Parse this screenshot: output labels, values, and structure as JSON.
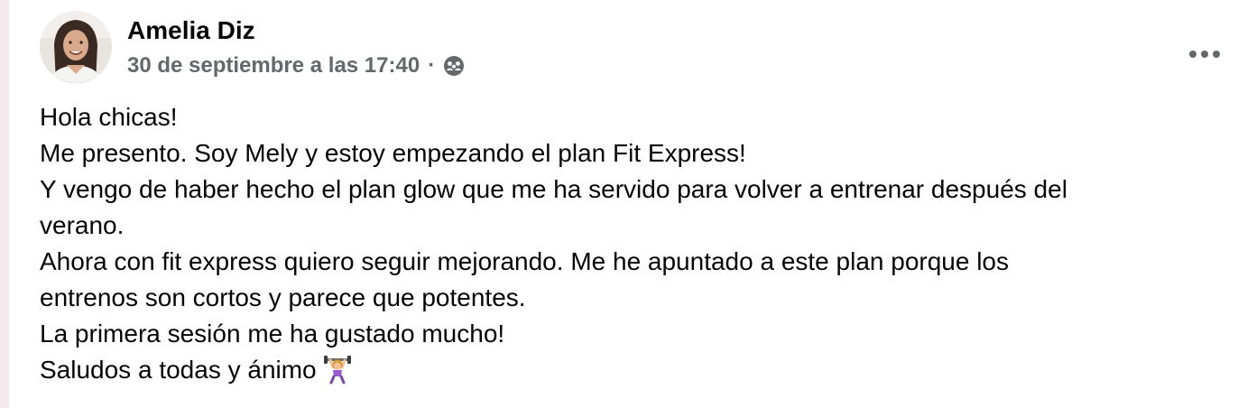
{
  "post": {
    "author_name": "Amelia Diz",
    "timestamp": "30 de septiembre a las 17:40",
    "separator": "·",
    "audience_icon": "group-audience-icon",
    "more_icon": "more-options-icon",
    "avatar_icon": "profile-photo",
    "lines": [
      "Hola chicas!",
      "Me presento. Soy Mely y estoy empezando el plan Fit Express!",
      "Y vengo de haber hecho el plan glow que me ha servido para volver a entrenar después del",
      "verano.",
      "Ahora con fit express quiero seguir mejorando. Me he apuntado a este plan porque los",
      "entrenos son cortos y parece que potentes.",
      "La primera sesión me ha gustado mucho!",
      "Saludos a todas y ánimo"
    ],
    "final_emoji": "woman-lifting-weights-emoji"
  },
  "colors": {
    "text_primary": "#050505",
    "text_secondary": "#65676b",
    "background": "#ffffff"
  }
}
